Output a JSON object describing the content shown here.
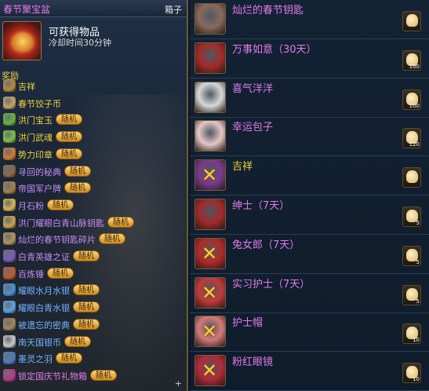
{
  "left_panel": {
    "title": "春节聚宝盆",
    "tab": "箱子",
    "box_name": "可获得物品",
    "cooldown": "冷却时间30分钟",
    "rewards_label": "奖励",
    "plus": "+",
    "rewards": [
      {
        "name": "吉祥",
        "color": "#f0d43a",
        "badge": "",
        "icon_color": "#b88a3a"
      },
      {
        "name": "春节饺子币",
        "color": "#f0d43a",
        "badge": "",
        "icon_color": "#c9a560"
      },
      {
        "name": "洪门宝玉",
        "color": "#f0d43a",
        "badge": "随机",
        "icon_color": "#69b63a"
      },
      {
        "name": "洪门武魂",
        "color": "#f0d43a",
        "badge": "随机",
        "icon_color": "#7ec43e"
      },
      {
        "name": "势力印章",
        "color": "#f0d43a",
        "badge": "随机",
        "icon_color": "#d57c2c"
      },
      {
        "name": "寻回的秘典",
        "color": "#c48bf0",
        "badge": "随机",
        "icon_color": "#8c6a3e"
      },
      {
        "name": "帝国军户牌",
        "color": "#c48bf0",
        "badge": "随机",
        "icon_color": "#a7824b"
      },
      {
        "name": "月石粉",
        "color": "#c48bf0",
        "badge": "随机",
        "icon_color": "#d8b851"
      },
      {
        "name": "洪门耀眼白青山脉钥匙",
        "color": "#c48bf0",
        "badge": "随机",
        "icon_color": "#c9a34e"
      },
      {
        "name": "灿烂的春节钥匙碎片",
        "color": "#c48bf0",
        "badge": "随机",
        "icon_color": "#b6965a"
      },
      {
        "name": "白青英雄之证",
        "color": "#c48bf0",
        "badge": "随机",
        "icon_color": "#7a5ab8"
      },
      {
        "name": "百炼锤",
        "color": "#c48bf0",
        "badge": "随机",
        "icon_color": "#c35a2a"
      },
      {
        "name": "耀眼水月水银",
        "color": "#6fb2ff",
        "badge": "随机",
        "icon_color": "#4a90d8"
      },
      {
        "name": "耀眼白青水银",
        "color": "#6fb2ff",
        "badge": "随机",
        "icon_color": "#5ea2e6"
      },
      {
        "name": "被遗忘的密典",
        "color": "#6fb2ff",
        "badge": "随机",
        "icon_color": "#a5865a"
      },
      {
        "name": "南天国银币",
        "color": "#6fb2ff",
        "badge": "随机",
        "icon_color": "#c8c8c8"
      },
      {
        "name": "墨灵之羽",
        "color": "#6fb2ff",
        "badge": "随机",
        "icon_color": "#4e7bc4"
      },
      {
        "name": "锁定国庆节礼物箱",
        "color": "#e27ae8",
        "badge": "随机",
        "icon_color": "#b83a8a"
      }
    ]
  },
  "right_panel": {
    "items": [
      {
        "name": "灿烂的春节钥匙",
        "color": "#e27ae8",
        "icon_color": "#8a6a5a",
        "locked": false,
        "bag_count": ""
      },
      {
        "name": "万事如意（30天）",
        "color": "#e27ae8",
        "icon_color": "#a42a2a",
        "locked": false,
        "bag_count": "100"
      },
      {
        "name": "喜气洋洋",
        "color": "#e27ae8",
        "icon_color": "#d8d8d8",
        "locked": false,
        "bag_count": "100"
      },
      {
        "name": "幸运包子",
        "color": "#e27ae8",
        "icon_color": "#e6c7c4",
        "locked": false,
        "bag_count": "120"
      },
      {
        "name": "吉祥",
        "color": "#f0d43a",
        "icon_color": "#7a3a8a",
        "locked": true,
        "bag_count": ""
      },
      {
        "name": "绅士（7天）",
        "color": "#e27ae8",
        "icon_color": "#a12a2a",
        "locked": false,
        "bag_count": "5"
      },
      {
        "name": "兔女郎（7天）",
        "color": "#e27ae8",
        "icon_color": "#b12a2a",
        "locked": true,
        "bag_count": "5"
      },
      {
        "name": "实习护士（7天）",
        "color": "#e27ae8",
        "icon_color": "#c23a3a",
        "locked": true,
        "bag_count": "5"
      },
      {
        "name": "护士帽",
        "color": "#e27ae8",
        "icon_color": "#d47a7a",
        "locked": true,
        "bag_count": "10"
      },
      {
        "name": "粉红眼镜",
        "color": "#e27ae8",
        "icon_color": "#b22a3a",
        "locked": true,
        "bag_count": "10"
      }
    ]
  }
}
